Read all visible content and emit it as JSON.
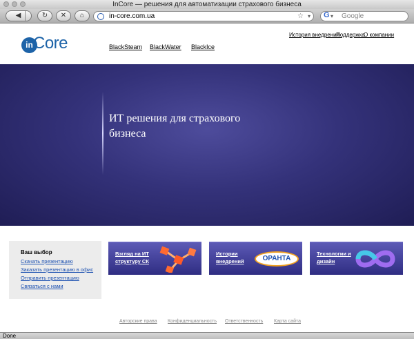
{
  "window": {
    "title": "InCore — решения для автоматизации страхового бизнеса"
  },
  "toolbar": {
    "address": "in-core.com.ua",
    "search_placeholder": "Google",
    "search_engine": "G",
    "icons": [
      "back-icon",
      "forward-icon",
      "reload-icon",
      "stop-icon",
      "home-icon",
      "globe-icon",
      "bookmark-star-icon"
    ]
  },
  "site": {
    "logo": {
      "prefix": "in",
      "name": "Core"
    },
    "nav": [
      "BlackSteam",
      "BlackWater",
      "BlackIce"
    ],
    "top_links": [
      "История внедрения",
      "Поддержка",
      "О компании"
    ],
    "hero": {
      "heading": "ИТ решения для страхового бизнеса"
    },
    "sidebar": {
      "title": "Ваш выбор",
      "links": [
        "Скачать презентацию",
        "Заказать презентацию в офис",
        "Отправить презентацию",
        "Связаться с нами"
      ]
    },
    "banners": [
      {
        "label": "Взгляд на ИТ структуру СК"
      },
      {
        "label": "Истории внедрений",
        "brand": "ОРАНТА"
      },
      {
        "label": "Технологии и дизайн"
      }
    ],
    "footer": [
      "Авторские права",
      "Конфиденциальность",
      "Ответственность",
      "Карта сайта"
    ]
  },
  "status": {
    "text": "Done"
  },
  "colors": {
    "brand": "#1d63a8",
    "hero": "#34327a",
    "link": "#1a4fb0"
  }
}
